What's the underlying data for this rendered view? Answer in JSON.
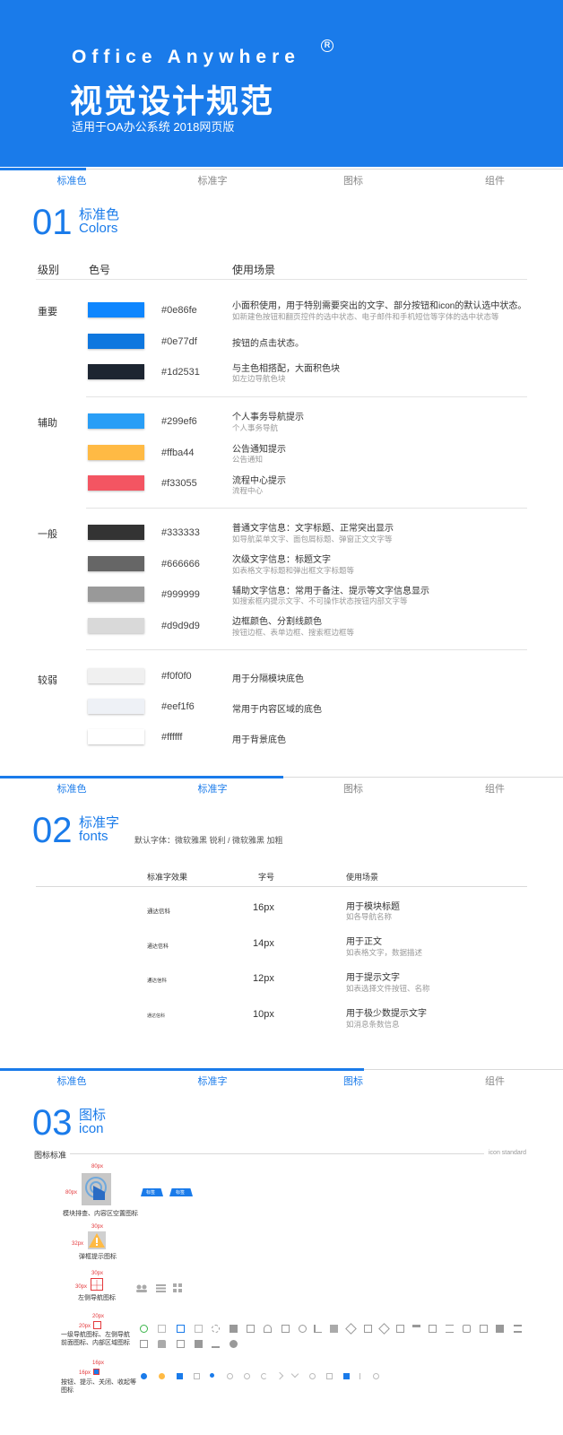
{
  "header": {
    "brand": "Office Anywhere",
    "reg": "R",
    "title": "视觉设计规范",
    "subtitle": "适用于OA办公系统   2018网页版"
  },
  "tabs": [
    "标准色",
    "标准字",
    "图标",
    "组件"
  ],
  "colors_section": {
    "num": "01",
    "cn": "标准色",
    "en": "Colors",
    "headers": {
      "level": "级别",
      "code": "色号",
      "usage": "使用场景"
    },
    "groups": [
      {
        "level": "重要",
        "items": [
          {
            "hex": "#0e86fe",
            "color": "#0e86fe",
            "usage": "小面积使用，用于特别需要突出的文字、部分按钮和icon的默认选中状态。",
            "sub": "如新建色按钮和翻页控件的选中状态、电子邮件和手机短信等字体的选中状态等"
          },
          {
            "hex": "#0e77df",
            "color": "#0e77df",
            "usage": "按钮的点击状态。",
            "sub": ""
          },
          {
            "hex": "#1d2531",
            "color": "#1d2531",
            "usage": "与主色相搭配，大面积色块",
            "sub": "如左边导航色块"
          }
        ]
      },
      {
        "level": "辅助",
        "items": [
          {
            "hex": "#299ef6",
            "color": "#299ef6",
            "usage": "个人事务导航提示",
            "sub": "个人事务导航"
          },
          {
            "hex": "#ffba44",
            "color": "#ffba44",
            "usage": "公告通知提示",
            "sub": "公告通知"
          },
          {
            "hex": "#f33055",
            "color": "#f35562",
            "usage": "流程中心提示",
            "sub": "流程中心"
          }
        ]
      },
      {
        "level": "一般",
        "items": [
          {
            "hex": "#333333",
            "color": "#333333",
            "usage": "普通文字信息：文字标题、正常突出显示",
            "sub": "如导航菜单文字、面包屑标题、弹窗正文文字等"
          },
          {
            "hex": "#666666",
            "color": "#666666",
            "usage": "次级文字信息：标题文字",
            "sub": "如表格文字标题和弹出框文字标题等"
          },
          {
            "hex": "#999999",
            "color": "#999999",
            "usage": "辅助文字信息：常用于备注、提示等文字信息显示",
            "sub": "如搜索框内提示文字、不可操作状态按钮内部文字等"
          },
          {
            "hex": "#d9d9d9",
            "color": "#d9d9d9",
            "usage": "边框颜色、分割线颜色",
            "sub": "按钮边框、表单边框、搜索框边框等"
          }
        ]
      },
      {
        "level": "较弱",
        "items": [
          {
            "hex": "#f0f0f0",
            "color": "#f0f0f0",
            "usage": "用于分隔模块底色",
            "sub": ""
          },
          {
            "hex": "#eef1f6",
            "color": "#eef1f6",
            "usage": "常用于内容区域的底色",
            "sub": ""
          },
          {
            "hex": "#ffffff",
            "color": "#ffffff",
            "usage": "用于背景底色",
            "sub": ""
          }
        ]
      }
    ]
  },
  "fonts_section": {
    "num": "02",
    "cn": "标准字",
    "en": "fonts",
    "note": "默认字体：微软雅黑 锐利 / 微软雅黑 加粗",
    "headers": {
      "effect": "标准字效果",
      "size": "字号",
      "usage": "使用场景"
    },
    "rows": [
      {
        "sample": "通达信科",
        "size": "16px",
        "usage": "用于模块标题",
        "sub": "如各导航名称"
      },
      {
        "sample": "通达信科",
        "size": "14px",
        "usage": "用于正文",
        "sub": "如表格文字，数据描述"
      },
      {
        "sample": "通达信科",
        "size": "12px",
        "usage": "用于提示文字",
        "sub": "如表选择文件按钮、名称"
      },
      {
        "sample": "通达信科",
        "size": "10px",
        "usage": "用于极少数提示文字",
        "sub": "如消息条数信息"
      }
    ]
  },
  "icon_section": {
    "num": "03",
    "cn": "图标",
    "en": "icon",
    "std_label": "图标标准",
    "std_label_en": "icon standard",
    "dims": {
      "d80": "80px",
      "d30": "30px",
      "d32": "32px",
      "d20": "20px",
      "d16": "16px"
    },
    "captions": {
      "c1": "模块排查、内容区空置图标",
      "c2": "弹框提示图标",
      "c3": "左侧导航图标",
      "c4": "一级导航图标、左侧导航前面图标、内部区域图标",
      "c5": "按钮、提示、关闭、收起等图标"
    },
    "mini_tab": "标签"
  }
}
